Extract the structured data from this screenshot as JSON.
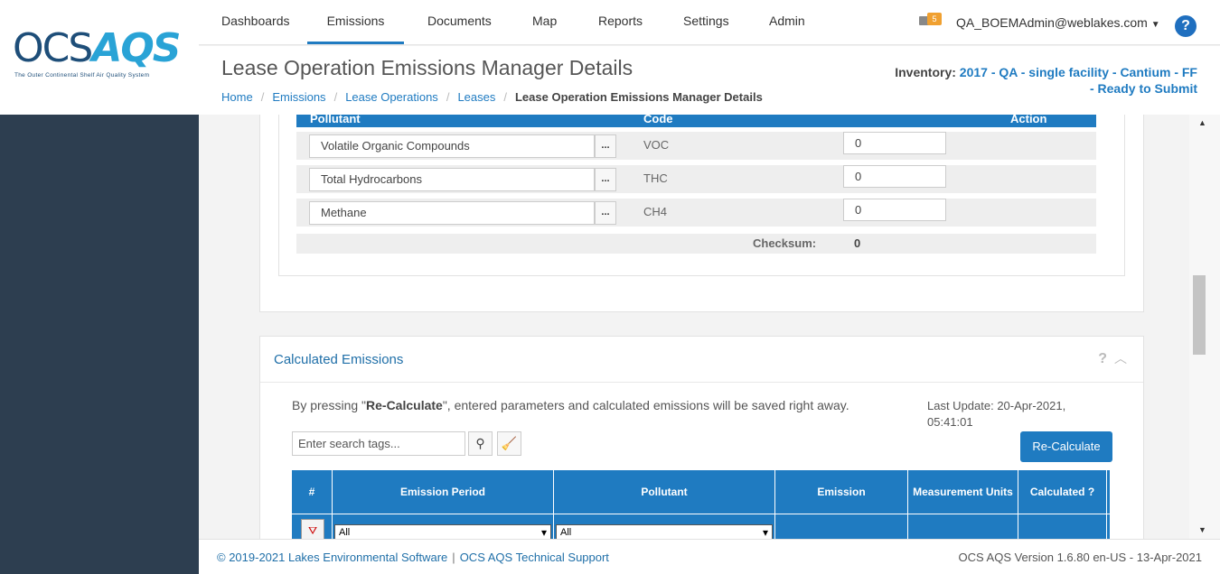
{
  "logo": {
    "ocs": "OCS",
    "aqs": "AQS",
    "tagline": "The Outer Continental Shelf Air Quality System"
  },
  "nav": {
    "items": [
      "Dashboards",
      "Emissions",
      "Documents",
      "Map",
      "Reports",
      "Settings",
      "Admin"
    ],
    "active": "Emissions",
    "mail_count": "5",
    "user": "QA_BOEMAdmin@weblakes.com",
    "help": "?"
  },
  "header": {
    "title": "Lease Operation Emissions Manager Details",
    "breadcrumb": [
      "Home",
      "Emissions",
      "Lease Operations",
      "Leases",
      "Lease Operation Emissions Manager Details"
    ],
    "inventory_label": "Inventory:",
    "inventory_value_1": "2017 - QA - single facility - Cantium - FF",
    "inventory_value_2": "- Ready to Submit"
  },
  "pollutant_table": {
    "headers": {
      "pollutant": "Pollutant",
      "code": "Code",
      "action": "Action"
    },
    "rows": [
      {
        "name": "Volatile Organic Compounds",
        "code": "VOC",
        "value": "0",
        "button": "..."
      },
      {
        "name": "Total Hydrocarbons",
        "code": "THC",
        "value": "0",
        "button": "..."
      },
      {
        "name": "Methane",
        "code": "CH4",
        "value": "0",
        "button": "..."
      }
    ],
    "checksum_label": "Checksum:",
    "checksum_value": "0"
  },
  "calculated": {
    "title": "Calculated Emissions",
    "help": "?",
    "info_prefix": "By pressing \"",
    "info_bold": "Re-Calculate",
    "info_suffix": "\", entered parameters and calculated emissions will be saved right away.",
    "last_update": "Last Update: 20-Apr-2021, 05:41:01",
    "search_placeholder": "Enter search tags...",
    "recalc_button": "Re-Calculate",
    "grid_headers": [
      "#",
      "Emission Period",
      "Pollutant",
      "Emission",
      "Measurement Units",
      "Calculated ?"
    ],
    "filter_period": "All",
    "filter_pollutant": "All"
  },
  "footer": {
    "copyright": "© 2019-2021 Lakes Environmental Software",
    "support": "OCS AQS Technical Support",
    "version": "OCS AQS Version 1.6.80 en-US - 13-Apr-2021"
  }
}
